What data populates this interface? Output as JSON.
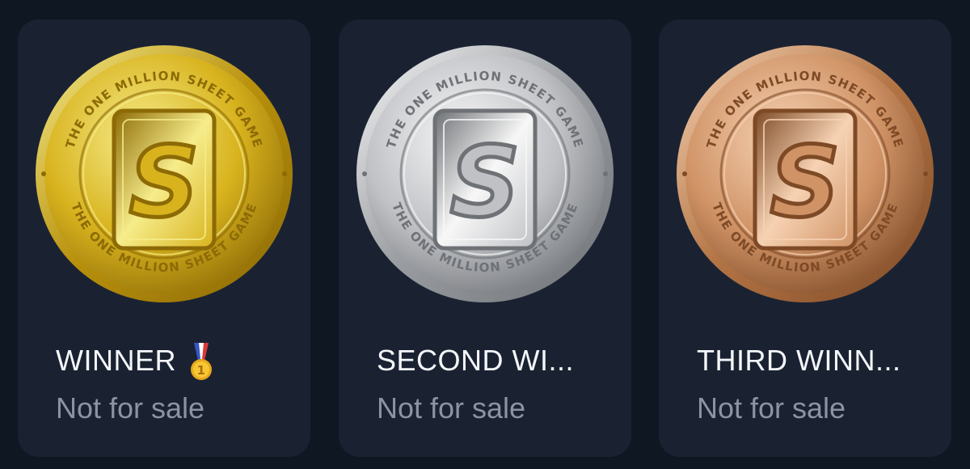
{
  "cards": [
    {
      "title": "WINNER",
      "badge": "medal-icon",
      "status": "Not for sale",
      "coin": {
        "emblem_letter": "S",
        "ring_text": "THE ONE MILLION SHEET GAME",
        "finish": "gold",
        "colors": {
          "light": "#f6ec8a",
          "mid": "#d8b31e",
          "dark": "#8c6a06",
          "edge": "#b8900c"
        }
      }
    },
    {
      "title": "SECOND WI...",
      "status": "Not for sale",
      "coin": {
        "emblem_letter": "S",
        "ring_text": "THE ONE MILLION SHEET GAME",
        "finish": "silver",
        "colors": {
          "light": "#f7f7f7",
          "mid": "#bfc1c5",
          "dark": "#6e7175",
          "edge": "#9a9da1"
        }
      }
    },
    {
      "title": "THIRD WINN...",
      "status": "Not for sale",
      "coin": {
        "emblem_letter": "S",
        "ring_text": "THE ONE MILLION SHEET GAME",
        "finish": "bronze",
        "colors": {
          "light": "#f6d2b3",
          "mid": "#d09366",
          "dark": "#7e4a26",
          "edge": "#b37444"
        }
      }
    }
  ],
  "theme": {
    "page_bg": "#0f1723",
    "card_bg": "#1a2232",
    "title_color": "#f4f6f9",
    "status_color": "#8c94a3"
  }
}
